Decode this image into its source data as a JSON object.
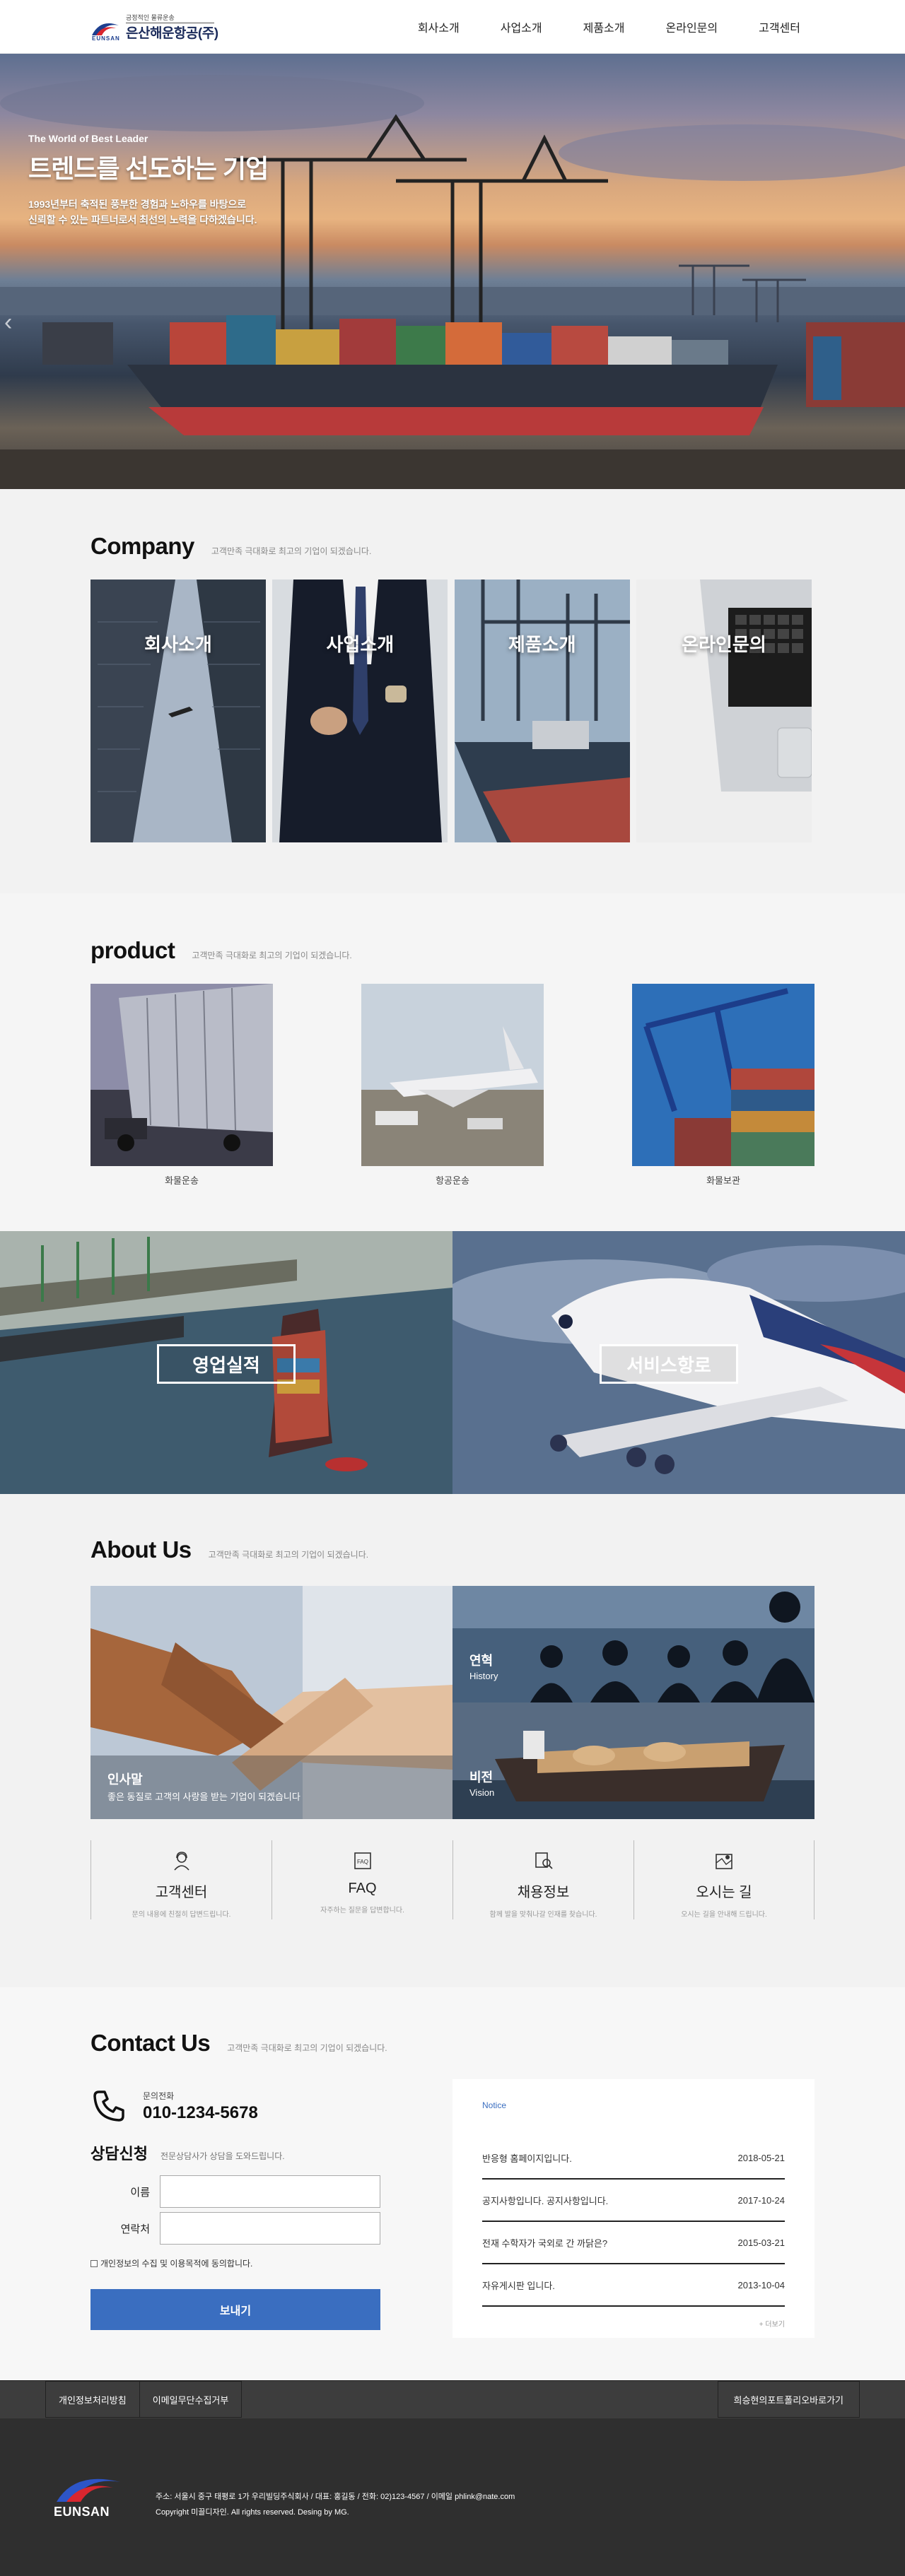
{
  "header": {
    "logo_slogan": "긍정적인 물류운송",
    "logo_name": "은산해운항공(주)",
    "logo_en": "EUNSAN",
    "nav": [
      "회사소개",
      "사업소개",
      "제품소개",
      "온라인문의",
      "고객센터"
    ]
  },
  "hero": {
    "small": "The World of Best Leader",
    "title": "트렌드를 선도하는 기업",
    "desc_line1": "1993년부터 축적된 풍부한 경험과 노하우를 바탕으로",
    "desc_line2": "신뢰할 수 있는 파트너로서 최선의 노력을 다하겠습니다."
  },
  "company": {
    "title": "Company",
    "subtitle": "고객만족 극대화로 최고의 기업이 되겠습니다.",
    "cards": [
      "회사소개",
      "사업소개",
      "제품소개",
      "온라인문의"
    ]
  },
  "product": {
    "title": "product",
    "subtitle": "고객만족 극대화로 최고의 기업이 되겠습니다.",
    "items": [
      "화물운송",
      "항공운송",
      "화물보관"
    ]
  },
  "banners": [
    "영업실적",
    "서비스항로"
  ],
  "about": {
    "title": "About Us",
    "subtitle": "고객만족 극대화로 최고의 기업이 되겠습니다.",
    "main_title": "인사말",
    "main_desc": "좋은 동질로 고객의 사랑을 받는 기업이 되겠습니다",
    "history_title": "연혁",
    "history_sub": "History",
    "vision_title": "비전",
    "vision_sub": "Vision",
    "quick": [
      {
        "title": "고객센터",
        "desc": "문의 내용에 친절히 답변드립니다."
      },
      {
        "title": "FAQ",
        "desc": "자주하는 질문을 답변합니다."
      },
      {
        "title": "채용정보",
        "desc": "함께 발을 맞춰나갈 인재를 찾습니다."
      },
      {
        "title": "오시는 길",
        "desc": "오시는 길을 안내해 드립니다."
      }
    ]
  },
  "contact": {
    "title": "Contact Us",
    "subtitle": "고객만족 극대화로 최고의 기업이 되겠습니다.",
    "phone_label": "문의전화",
    "phone": "010-1234-5678",
    "consult_title": "상담신청",
    "consult_sub": "전문상담사가 상담을 도와드립니다.",
    "name_label": "이름",
    "tel_label": "연락처",
    "agree": "개인정보의 수집 및 이용목적에 동의합니다.",
    "send": "보내기",
    "notice_title": "Notice",
    "notices": [
      {
        "title": "반응형 홈페이지입니다.",
        "date": "2018-05-21"
      },
      {
        "title": "공지사항입니다. 공지사항입니다.",
        "date": "2017-10-24"
      },
      {
        "title": "전재 수학자가 국외로 간 까닭은?",
        "date": "2015-03-21"
      },
      {
        "title": "자유게시판 입니다.",
        "date": "2013-10-04"
      }
    ],
    "more": "+ 더보기"
  },
  "footer": {
    "links": [
      "개인정보처리방침",
      "이메일무단수집거부"
    ],
    "right": "희승현의포트폴리오바로가기",
    "logo_text": "EUNSAN",
    "address": "주소: 서울시 중구 태평로 1가 우리빌딩주식회사 / 대표: 홍길동 / 전화: 02)123-4567 / 이메일 phlink@nate.com",
    "copyright": "Copyright 미끌디자인. All rights reserved. Desing by MG."
  },
  "colors": {
    "accent": "#3a6ec0",
    "brand_navy": "#1b2b5b",
    "footer_dark": "#2f2f2f"
  }
}
